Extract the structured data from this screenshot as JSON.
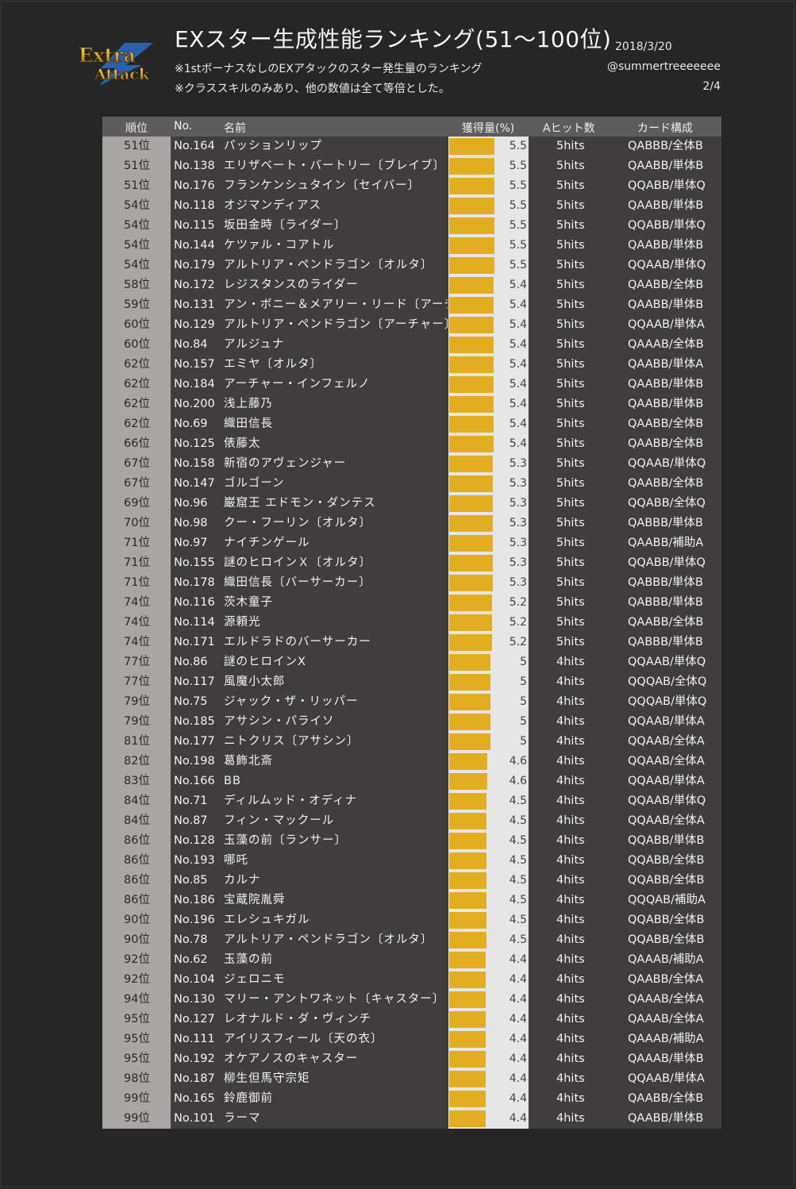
{
  "header": {
    "logo_text_1": "Extra",
    "logo_text_2": "Attack",
    "title": "EXスター生成性能ランキング(51～100位)",
    "note1": "※1stボーナスなしのEXアタックのスター発生量のランキング",
    "note2": "※クラススキルのみあり、他の数値は全て等倍とした。",
    "date": "2018/3/20",
    "author": "@summertreeeeeee",
    "page": "2/4"
  },
  "colors": {
    "bar": "#e3ad22",
    "rank_bg": "#a9a5a5",
    "row_bg": "#3f3d3d",
    "header_bg": "#5c5c5c"
  },
  "chart_data": {
    "type": "table",
    "xlim": [
      0,
      9.5
    ],
    "columns": [
      "順位",
      "No.",
      "名前",
      "獲得量(%)",
      "Aヒット数",
      "カード構成"
    ],
    "rows": [
      {
        "rank": "51位",
        "no": "No.164",
        "name": "パッションリップ",
        "value": 5.5,
        "hits": "5hits",
        "cards": "QABBB/全体B"
      },
      {
        "rank": "51位",
        "no": "No.138",
        "name": "エリザベート・バートリー〔ブレイブ〕",
        "value": 5.5,
        "hits": "5hits",
        "cards": "QAABB/単体B"
      },
      {
        "rank": "51位",
        "no": "No.176",
        "name": "フランケンシュタイン〔セイバー〕",
        "value": 5.5,
        "hits": "5hits",
        "cards": "QQABB/単体Q"
      },
      {
        "rank": "54位",
        "no": "No.118",
        "name": "オジマンディアス",
        "value": 5.5,
        "hits": "5hits",
        "cards": "QAABB/単体B"
      },
      {
        "rank": "54位",
        "no": "No.115",
        "name": "坂田金時〔ライダー〕",
        "value": 5.5,
        "hits": "5hits",
        "cards": "QQABB/単体Q"
      },
      {
        "rank": "54位",
        "no": "No.144",
        "name": "ケツァル・コアトル",
        "value": 5.5,
        "hits": "5hits",
        "cards": "QAABB/単体B"
      },
      {
        "rank": "54位",
        "no": "No.179",
        "name": "アルトリア・ペンドラゴン〔オルタ〕",
        "value": 5.5,
        "hits": "5hits",
        "cards": "QQAAB/単体Q"
      },
      {
        "rank": "58位",
        "no": "No.172",
        "name": "レジスタンスのライダー",
        "value": 5.4,
        "hits": "5hits",
        "cards": "QAABB/全体B"
      },
      {
        "rank": "59位",
        "no": "No.131",
        "name": "アン・ボニー＆メアリー・リード〔アーチャー〕",
        "value": 5.4,
        "hits": "5hits",
        "cards": "QAABB/単体B"
      },
      {
        "rank": "60位",
        "no": "No.129",
        "name": "アルトリア・ペンドラゴン〔アーチャー〕",
        "value": 5.4,
        "hits": "5hits",
        "cards": "QQAAB/単体A"
      },
      {
        "rank": "60位",
        "no": "No.84",
        "name": "アルジュナ",
        "value": 5.4,
        "hits": "5hits",
        "cards": "QAAAB/全体B"
      },
      {
        "rank": "62位",
        "no": "No.157",
        "name": "エミヤ〔オルタ〕",
        "value": 5.4,
        "hits": "5hits",
        "cards": "QAABB/単体A"
      },
      {
        "rank": "62位",
        "no": "No.184",
        "name": "アーチャー・インフェルノ",
        "value": 5.4,
        "hits": "5hits",
        "cards": "QAABB/単体B"
      },
      {
        "rank": "62位",
        "no": "No.200",
        "name": "浅上藤乃",
        "value": 5.4,
        "hits": "5hits",
        "cards": "QAABB/単体B"
      },
      {
        "rank": "62位",
        "no": "No.69",
        "name": "織田信長",
        "value": 5.4,
        "hits": "5hits",
        "cards": "QAABB/全体B"
      },
      {
        "rank": "66位",
        "no": "No.125",
        "name": "俵藤太",
        "value": 5.4,
        "hits": "5hits",
        "cards": "QAABB/全体B"
      },
      {
        "rank": "67位",
        "no": "No.158",
        "name": "新宿のアヴェンジャー",
        "value": 5.3,
        "hits": "5hits",
        "cards": "QQAAB/単体Q"
      },
      {
        "rank": "67位",
        "no": "No.147",
        "name": "ゴルゴーン",
        "value": 5.3,
        "hits": "5hits",
        "cards": "QAABB/全体B"
      },
      {
        "rank": "69位",
        "no": "No.96",
        "name": "巌窟王 エドモン・ダンテス",
        "value": 5.3,
        "hits": "5hits",
        "cards": "QQABB/全体Q"
      },
      {
        "rank": "70位",
        "no": "No.98",
        "name": "クー・フーリン〔オルタ〕",
        "value": 5.3,
        "hits": "5hits",
        "cards": "QABBB/単体B"
      },
      {
        "rank": "71位",
        "no": "No.97",
        "name": "ナイチンゲール",
        "value": 5.3,
        "hits": "5hits",
        "cards": "QAABB/補助A"
      },
      {
        "rank": "71位",
        "no": "No.155",
        "name": "謎のヒロインＸ〔オルタ〕",
        "value": 5.3,
        "hits": "5hits",
        "cards": "QQABB/単体Q"
      },
      {
        "rank": "71位",
        "no": "No.178",
        "name": "織田信長〔バーサーカー〕",
        "value": 5.3,
        "hits": "5hits",
        "cards": "QABBB/単体B"
      },
      {
        "rank": "74位",
        "no": "No.116",
        "name": "茨木童子",
        "value": 5.2,
        "hits": "5hits",
        "cards": "QABBB/単体B"
      },
      {
        "rank": "74位",
        "no": "No.114",
        "name": "源頼光",
        "value": 5.2,
        "hits": "5hits",
        "cards": "QAABB/全体B"
      },
      {
        "rank": "74位",
        "no": "No.171",
        "name": "エルドラドのバーサーカー",
        "value": 5.2,
        "hits": "5hits",
        "cards": "QABBB/単体B"
      },
      {
        "rank": "77位",
        "no": "No.86",
        "name": "謎のヒロインX",
        "value": 5,
        "hits": "4hits",
        "cards": "QQAAB/単体Q"
      },
      {
        "rank": "77位",
        "no": "No.117",
        "name": "風魔小太郎",
        "value": 5,
        "hits": "4hits",
        "cards": "QQQAB/全体Q"
      },
      {
        "rank": "79位",
        "no": "No.75",
        "name": "ジャック・ザ・リッパー",
        "value": 5,
        "hits": "4hits",
        "cards": "QQQAB/単体Q"
      },
      {
        "rank": "79位",
        "no": "No.185",
        "name": "アサシン・パライソ",
        "value": 5,
        "hits": "4hits",
        "cards": "QQAAB/単体A"
      },
      {
        "rank": "81位",
        "no": "No.177",
        "name": "ニトクリス〔アサシン〕",
        "value": 5,
        "hits": "4hits",
        "cards": "QQAAB/全体A"
      },
      {
        "rank": "82位",
        "no": "No.198",
        "name": "葛飾北斎",
        "value": 4.6,
        "hits": "4hits",
        "cards": "QQAAB/全体A"
      },
      {
        "rank": "83位",
        "no": "No.166",
        "name": "BB",
        "value": 4.6,
        "hits": "4hits",
        "cards": "QQAAB/単体A"
      },
      {
        "rank": "84位",
        "no": "No.71",
        "name": "ディルムッド・オディナ",
        "value": 4.5,
        "hits": "4hits",
        "cards": "QQAAB/単体Q"
      },
      {
        "rank": "84位",
        "no": "No.87",
        "name": "フィン・マックール",
        "value": 4.5,
        "hits": "4hits",
        "cards": "QQAAB/全体A"
      },
      {
        "rank": "86位",
        "no": "No.128",
        "name": "玉藻の前〔ランサー〕",
        "value": 4.5,
        "hits": "4hits",
        "cards": "QQABB/単体B"
      },
      {
        "rank": "86位",
        "no": "No.193",
        "name": "哪吒",
        "value": 4.5,
        "hits": "4hits",
        "cards": "QQABB/全体B"
      },
      {
        "rank": "86位",
        "no": "No.85",
        "name": "カルナ",
        "value": 4.5,
        "hits": "4hits",
        "cards": "QQABB/全体B"
      },
      {
        "rank": "86位",
        "no": "No.186",
        "name": "宝蔵院胤舜",
        "value": 4.5,
        "hits": "4hits",
        "cards": "QQQAB/補助A"
      },
      {
        "rank": "90位",
        "no": "No.196",
        "name": "エレシュキガル",
        "value": 4.5,
        "hits": "4hits",
        "cards": "QQABB/全体B"
      },
      {
        "rank": "90位",
        "no": "No.78",
        "name": "アルトリア・ペンドラゴン〔オルタ〕",
        "value": 4.5,
        "hits": "4hits",
        "cards": "QQABB/全体B"
      },
      {
        "rank": "92位",
        "no": "No.62",
        "name": "玉藻の前",
        "value": 4.4,
        "hits": "4hits",
        "cards": "QAAAB/補助A"
      },
      {
        "rank": "92位",
        "no": "No.104",
        "name": "ジェロニモ",
        "value": 4.4,
        "hits": "4hits",
        "cards": "QAABB/全体A"
      },
      {
        "rank": "94位",
        "no": "No.130",
        "name": "マリー・アントワネット〔キャスター〕",
        "value": 4.4,
        "hits": "4hits",
        "cards": "QAAAB/全体A"
      },
      {
        "rank": "95位",
        "no": "No.127",
        "name": "レオナルド・ダ・ヴィンチ",
        "value": 4.4,
        "hits": "4hits",
        "cards": "QAAAB/全体A"
      },
      {
        "rank": "95位",
        "no": "No.111",
        "name": "アイリスフィール〔天の衣〕",
        "value": 4.4,
        "hits": "4hits",
        "cards": "QAAAB/補助A"
      },
      {
        "rank": "95位",
        "no": "No.192",
        "name": "オケアノスのキャスター",
        "value": 4.4,
        "hits": "4hits",
        "cards": "QAAAB/単体B"
      },
      {
        "rank": "98位",
        "no": "No.187",
        "name": "柳生但馬守宗矩",
        "value": 4.4,
        "hits": "4hits",
        "cards": "QQAAB/単体A"
      },
      {
        "rank": "99位",
        "no": "No.165",
        "name": "鈴鹿御前",
        "value": 4.4,
        "hits": "4hits",
        "cards": "QAABB/全体B"
      },
      {
        "rank": "99位",
        "no": "No.101",
        "name": "ラーマ",
        "value": 4.4,
        "hits": "4hits",
        "cards": "QAABB/単体B"
      }
    ]
  }
}
